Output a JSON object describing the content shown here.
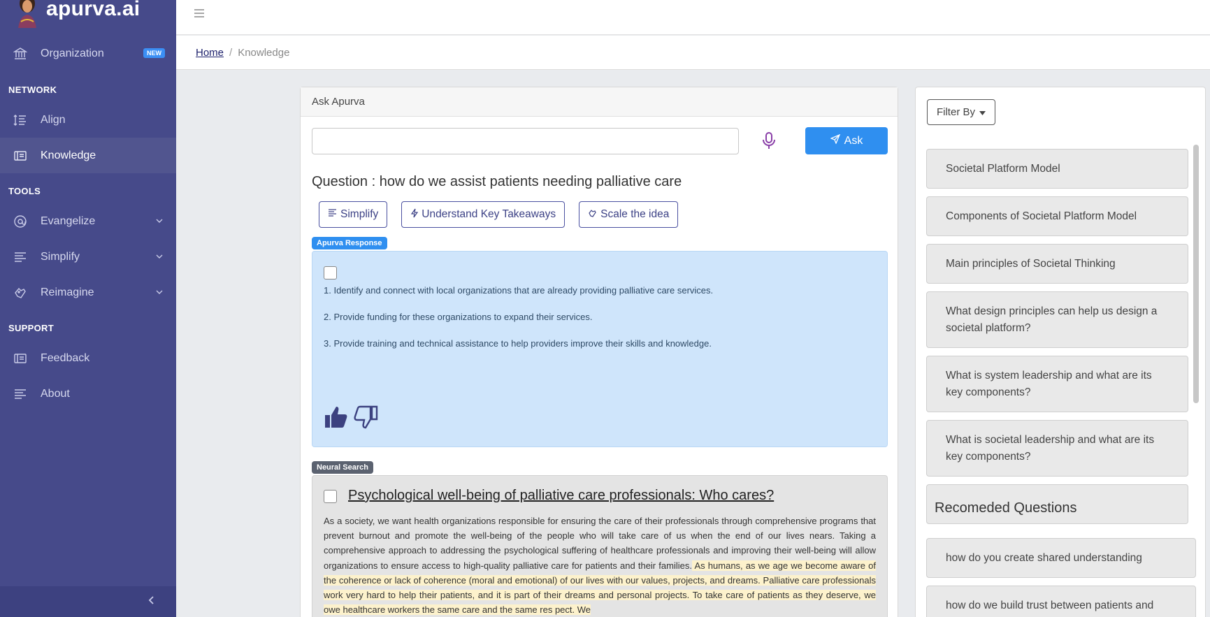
{
  "brand": {
    "title": "apurva.ai"
  },
  "sidebar": {
    "organization": {
      "label": "Organization",
      "badge": "NEW"
    },
    "sections": {
      "network": "NETWORK",
      "tools": "TOOLS",
      "support": "SUPPORT"
    },
    "network_items": [
      {
        "label": "Align",
        "icon": "align-list-icon"
      },
      {
        "label": "Knowledge",
        "icon": "knowledge-icon",
        "active": true
      }
    ],
    "tools_items": [
      {
        "label": "Evangelize",
        "icon": "at-sign-icon"
      },
      {
        "label": "Simplify",
        "icon": "lines-icon"
      },
      {
        "label": "Reimagine",
        "icon": "reimagine-hand-icon"
      }
    ],
    "support_items": [
      {
        "label": "Feedback",
        "icon": "feedback-icon"
      },
      {
        "label": "About",
        "icon": "about-lines-icon"
      }
    ]
  },
  "breadcrumb": {
    "home": "Home",
    "separator": "/",
    "current": "Knowledge"
  },
  "ask": {
    "header": "Ask Apurva",
    "input_value": "",
    "button": "Ask",
    "question": "Question : how do we assist patients needing palliative care",
    "actions": [
      "Simplify",
      "Understand Key Takeaways",
      "Scale the idea"
    ]
  },
  "response": {
    "tag": "Apurva Response",
    "lines": [
      "1. Identify and connect with local organizations that are already providing palliative care services.",
      "2. Provide funding for these organizations to expand their services.",
      "3. Provide training and technical assistance to help providers improve their skills and knowledge."
    ]
  },
  "neural": {
    "tag": "Neural Search",
    "title": "Psychological well-being of palliative care professionals: Who cares?",
    "text_plain": "As a society, we want health organizations responsible for ensuring the care of their professionals through comprehensive programs that prevent burnout and promote the well-being of the people who will take care of us when the end of our lives nears. Taking a comprehensive approach to addressing the psychological suffering of healthcare professionals and improving their well-being will allow organizations to ensure access to high-quality palliative care for patients and their families.",
    "text_highlight": " As humans, as we age we become aware of the coherence or lack of coherence (moral and emotional) of our lives with our values, projects, and dreams. Palliative care professionals work very hard to help their patients, and it is part of their dreams and personal projects. To take care of patients as they deserve, we owe healthcare workers the same care and the same res pect. We"
  },
  "filter": {
    "button": "Filter By",
    "items": [
      "Societal Platform Model",
      "Components of Societal Platform Model",
      "Main principles of Societal Thinking",
      "What design principles can help us design a societal platform?",
      "What is system leadership and what are its key components?",
      "What is societal leadership and what are its key components?"
    ]
  },
  "recommended": {
    "title": "Recomeded Questions",
    "items": [
      "how do you create shared understanding",
      "how do we build trust between patients and"
    ]
  },
  "colors": {
    "sidebar": "#464a8a",
    "accent": "#2f8ff0",
    "response_bg": "#cfe5fb",
    "highlight": "#fdf2cc"
  }
}
